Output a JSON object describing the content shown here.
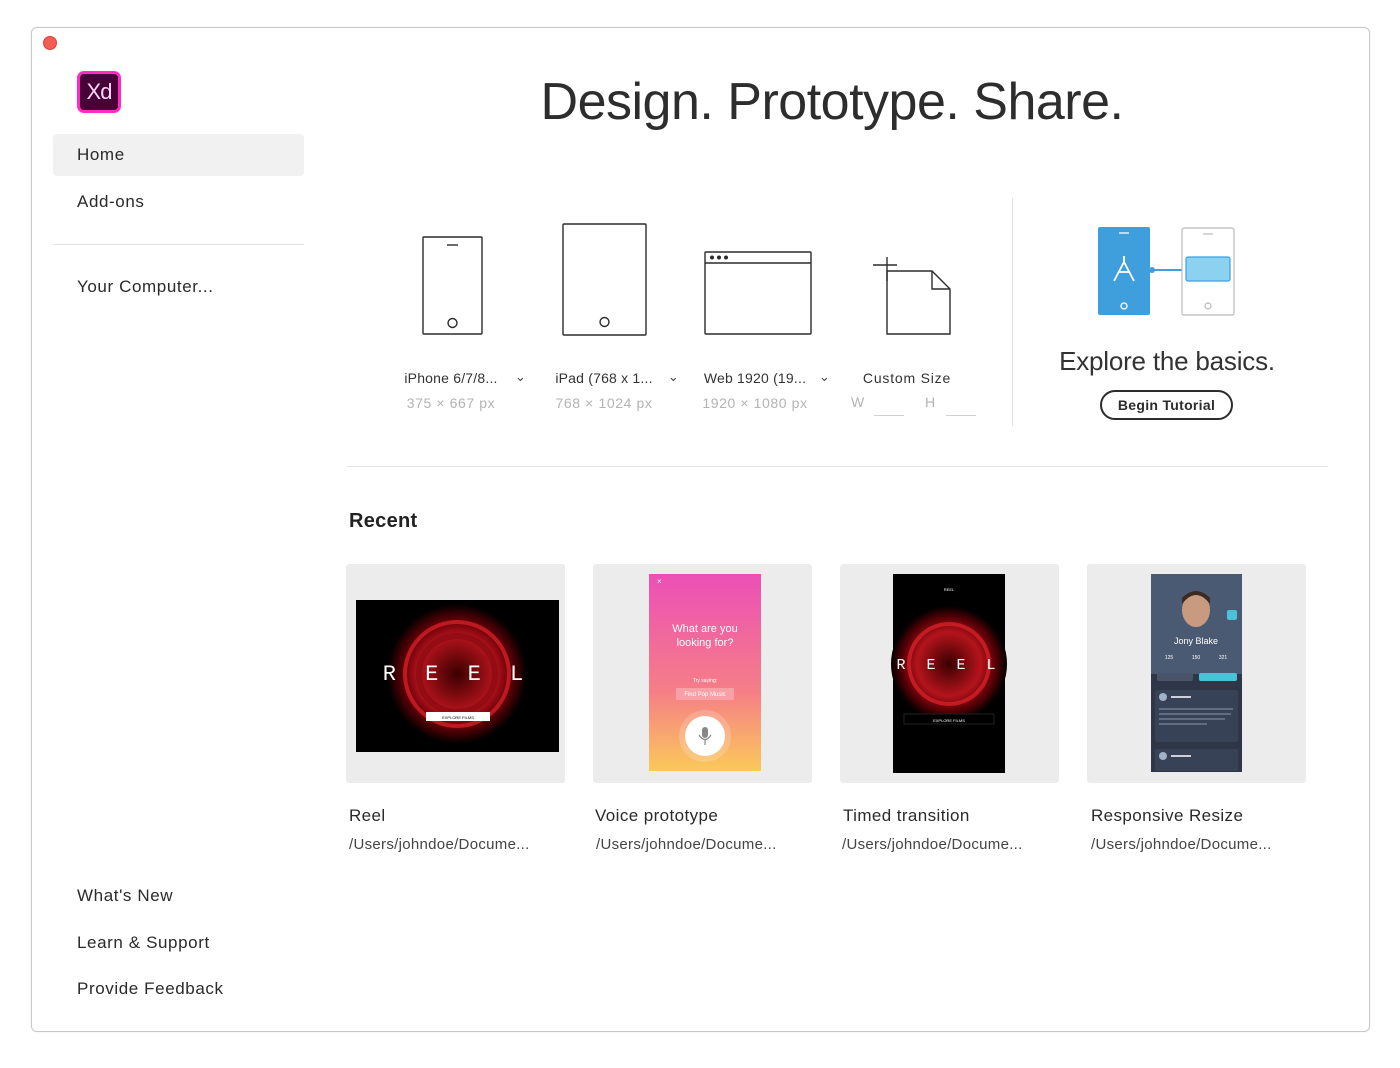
{
  "app": {
    "logo_text": "Xd"
  },
  "sidebar": {
    "items": [
      {
        "label": "Home"
      },
      {
        "label": "Add-ons"
      }
    ],
    "computer_label": "Your Computer...",
    "footer": [
      {
        "label": "What's New"
      },
      {
        "label": "Learn & Support"
      },
      {
        "label": "Provide Feedback"
      }
    ]
  },
  "header": {
    "title": "Design. Prototype. Share."
  },
  "presets": [
    {
      "name": "iPhone 6/7/8...",
      "dims": "375 × 667 px",
      "icon": "phone-icon"
    },
    {
      "name": "iPad (768 x 1...",
      "dims": "768 × 1024 px",
      "icon": "tablet-icon"
    },
    {
      "name": "Web 1920 (19...",
      "dims": "1920 × 1080 px",
      "icon": "browser-icon"
    }
  ],
  "custom": {
    "name": "Custom Size",
    "w_label": "W",
    "h_label": "H",
    "w_value": "",
    "h_value": ""
  },
  "tutorial": {
    "title": "Explore the basics.",
    "button_label": "Begin Tutorial"
  },
  "recent": {
    "title": "Recent",
    "files": [
      {
        "name": "Reel",
        "path": "/Users/johndoe/Docume...",
        "thumb_text": "R E E L",
        "thumb_button": "EXPLORE FILMS"
      },
      {
        "name": "Voice prototype",
        "path": "/Users/johndoe/Docume...",
        "thumb_text": "What are you looking for?",
        "thumb_sub": "Try saying:",
        "thumb_chip": "Find Pop Music"
      },
      {
        "name": "Timed transition",
        "path": "/Users/johndoe/Docume...",
        "thumb_text": "R E E L",
        "thumb_header": "REEL",
        "thumb_button": "EXPLORE FILMS"
      },
      {
        "name": "Responsive Resize",
        "path": "/Users/johndoe/Docume...",
        "thumb_text": "Jony Blake",
        "thumb_stats": [
          "125",
          "150",
          "321"
        ]
      }
    ]
  },
  "colors": {
    "close": "#f25c54",
    "accent_blue": "#3e9fdc",
    "logo_bg": "#470137",
    "logo_border": "#ff2bc2"
  }
}
